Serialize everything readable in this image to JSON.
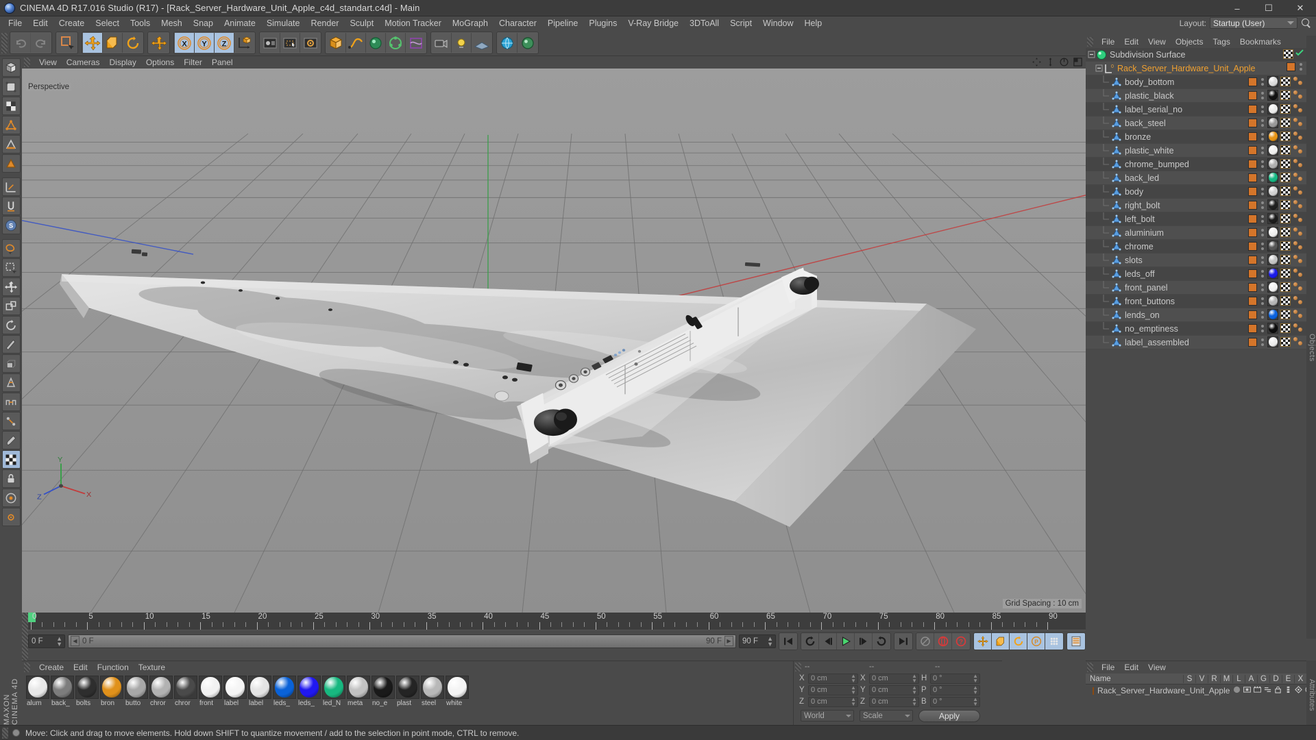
{
  "window": {
    "title": "CINEMA 4D R17.016 Studio (R17) - [Rack_Server_Hardware_Unit_Apple_c4d_standart.c4d] - Main",
    "minimize": "–",
    "maximize": "☐",
    "close": "✕"
  },
  "menubar": {
    "items": [
      "File",
      "Edit",
      "Create",
      "Select",
      "Tools",
      "Mesh",
      "Snap",
      "Animate",
      "Simulate",
      "Render",
      "Sculpt",
      "Motion Tracker",
      "MoGraph",
      "Character",
      "Pipeline",
      "Plugins",
      "V-Ray Bridge",
      "3DToAll",
      "Script",
      "Window",
      "Help"
    ],
    "layout_label": "Layout:",
    "layout_value": "Startup (User)"
  },
  "viewport": {
    "menu": [
      "View",
      "Cameras",
      "Display",
      "Options",
      "Filter",
      "Panel"
    ],
    "camera_label": "Perspective",
    "grid_spacing": "Grid Spacing : 10 cm"
  },
  "timeline": {
    "ticks": [
      0,
      5,
      10,
      15,
      20,
      25,
      30,
      35,
      40,
      45,
      50,
      55,
      60,
      65,
      70,
      75,
      80,
      85,
      90
    ],
    "current_frame": "0 F",
    "preview_start": "0 F",
    "preview_end": "90 F",
    "end_frame": "90 F",
    "frame_field": "0 F"
  },
  "material_manager": {
    "menu": [
      "Create",
      "Edit",
      "Function",
      "Texture"
    ],
    "materials": [
      {
        "name": "alum",
        "color": "#e8e8e8"
      },
      {
        "name": "back_",
        "color": "#7d7d7d"
      },
      {
        "name": "bolts",
        "color": "#2e2e2e"
      },
      {
        "name": "bron",
        "color": "#e0911b"
      },
      {
        "name": "butto",
        "color": "#a8a8a8"
      },
      {
        "name": "chror",
        "color": "#b2b2b2"
      },
      {
        "name": "chror",
        "color": "#4a4a4a"
      },
      {
        "name": "front",
        "color": "#f2f2f2"
      },
      {
        "name": "label",
        "color": "#f5f5f5"
      },
      {
        "name": "label",
        "color": "#e4e4e4"
      },
      {
        "name": "leds_",
        "color": "#0a62d8"
      },
      {
        "name": "leds_",
        "color": "#2018f0"
      },
      {
        "name": "led_N",
        "color": "#18b880"
      },
      {
        "name": "meta",
        "color": "#c2c2c2"
      },
      {
        "name": "no_e",
        "color": "#1a1a1a"
      },
      {
        "name": "plast",
        "color": "#242424"
      },
      {
        "name": "steel",
        "color": "#b8b8b8"
      },
      {
        "name": "white",
        "color": "#f4f4f4"
      }
    ]
  },
  "coordinates": {
    "header": [
      "--",
      "--",
      "--"
    ],
    "rows": [
      {
        "pl": "X",
        "pv": "0 cm",
        "sl": "X",
        "sv": "0 cm",
        "rl": "H",
        "rv": "0 °"
      },
      {
        "pl": "Y",
        "pv": "0 cm",
        "sl": "Y",
        "sv": "0 cm",
        "rl": "P",
        "rv": "0 °"
      },
      {
        "pl": "Z",
        "pv": "0 cm",
        "sl": "Z",
        "sv": "0 cm",
        "rl": "B",
        "rv": "0 °"
      }
    ],
    "space": "World",
    "mode": "Scale",
    "apply": "Apply"
  },
  "object_manager": {
    "menu": [
      "File",
      "Edit",
      "View",
      "Objects",
      "Tags",
      "Bookmarks"
    ],
    "items": [
      {
        "label": "Subdivision Surface",
        "type": "generator",
        "indent": 0,
        "mat": null,
        "checked": true
      },
      {
        "label": "Rack_Server_Hardware_Unit_Apple",
        "type": "null",
        "indent": 1,
        "mat": null,
        "selected": true,
        "tagsq": "#d4752a"
      },
      {
        "label": "body_bottom",
        "type": "poly",
        "indent": 2,
        "mat": "#dcdcdc",
        "tagsq": "#d4752a"
      },
      {
        "label": "plastic_black",
        "type": "poly",
        "indent": 2,
        "mat": "#121212",
        "tagsq": "#d4752a"
      },
      {
        "label": "label_serial_no",
        "type": "poly",
        "indent": 2,
        "mat": "#ececec",
        "tagsq": "#d4752a"
      },
      {
        "label": "back_steel",
        "type": "poly",
        "indent": 2,
        "mat": "#9a9a9a",
        "tagsq": "#d4752a"
      },
      {
        "label": "bronze",
        "type": "poly",
        "indent": 2,
        "mat": "#e89415",
        "tagsq": "#d4752a"
      },
      {
        "label": "plastic_white",
        "type": "poly",
        "indent": 2,
        "mat": "#f0f0f0",
        "tagsq": "#d4752a"
      },
      {
        "label": "chrome_bumped",
        "type": "poly",
        "indent": 2,
        "mat": "#b0b0b0",
        "tagsq": "#d4752a"
      },
      {
        "label": "back_led",
        "type": "poly",
        "indent": 2,
        "mat": "#16b884",
        "tagsq": "#d4752a"
      },
      {
        "label": "body",
        "type": "poly",
        "indent": 2,
        "mat": "#d2d2d2",
        "tagsq": "#d4752a"
      },
      {
        "label": "right_bolt",
        "type": "poly",
        "indent": 2,
        "mat": "#202020",
        "tagsq": "#d4752a"
      },
      {
        "label": "left_bolt",
        "type": "poly",
        "indent": 2,
        "mat": "#1c1c1c",
        "tagsq": "#d4752a"
      },
      {
        "label": "aluminium",
        "type": "poly",
        "indent": 2,
        "mat": "#efefef",
        "tagsq": "#d4752a"
      },
      {
        "label": "chrome",
        "type": "poly",
        "indent": 2,
        "mat": "#565656",
        "tagsq": "#d4752a"
      },
      {
        "label": "slots",
        "type": "poly",
        "indent": 2,
        "mat": "#c4c4c4",
        "tagsq": "#d4752a"
      },
      {
        "label": "leds_off",
        "type": "poly",
        "indent": 2,
        "mat": "#1b1bea",
        "tagsq": "#d4752a"
      },
      {
        "label": "front_panel",
        "type": "poly",
        "indent": 2,
        "mat": "#f2f2f2",
        "tagsq": "#d4752a"
      },
      {
        "label": "front_buttons",
        "type": "poly",
        "indent": 2,
        "mat": "#b6b6b6",
        "tagsq": "#d4752a"
      },
      {
        "label": "lends_on",
        "type": "poly",
        "indent": 2,
        "mat": "#0a62e0",
        "tagsq": "#d4752a"
      },
      {
        "label": "no_emptiness",
        "type": "poly",
        "indent": 2,
        "mat": "#0d0d0d",
        "tagsq": "#d4752a"
      },
      {
        "label": "label_assembled",
        "type": "poly",
        "indent": 2,
        "mat": "#ededed",
        "tagsq": "#d4752a"
      }
    ]
  },
  "attribute_manager": {
    "menu": [
      "File",
      "Edit",
      "View"
    ],
    "columns": [
      "Name",
      "S",
      "V",
      "R",
      "M",
      "L",
      "A",
      "G",
      "D",
      "E",
      "X"
    ],
    "row_label": "Rack_Server_Hardware_Unit_Apple",
    "side_label": "Attributes"
  },
  "side_label_objects": "Objects",
  "status": {
    "text": "Move: Click and drag to move elements. Hold down SHIFT to quantize movement / add to the selection in point mode, CTRL to remove."
  },
  "brand": "MAXON CINEMA 4D",
  "toolbar": {
    "axis_buttons": [
      "X",
      "Y",
      "Z"
    ],
    "icons": [
      "undo-icon",
      "redo-icon",
      "select-icon",
      "move-icon",
      "scale-icon",
      "rotate-icon",
      "move2-icon",
      "axis-x",
      "axis-y",
      "axis-z",
      "world-coord-icon",
      "render-view-icon",
      "render-region-icon",
      "render-settings-icon",
      "cube-icon",
      "spline-icon",
      "nurbs-icon",
      "array-icon",
      "deformer-icon",
      "camera-icon",
      "light-icon",
      "scene-icon",
      "floor-icon"
    ]
  },
  "colors": {
    "accent_orange": "#d4752a",
    "panel_bg": "#4a4a4a",
    "dark_bg": "#3a3a3a",
    "selection_blue": "#a9c3e0",
    "green_marker": "#4fd17f"
  }
}
